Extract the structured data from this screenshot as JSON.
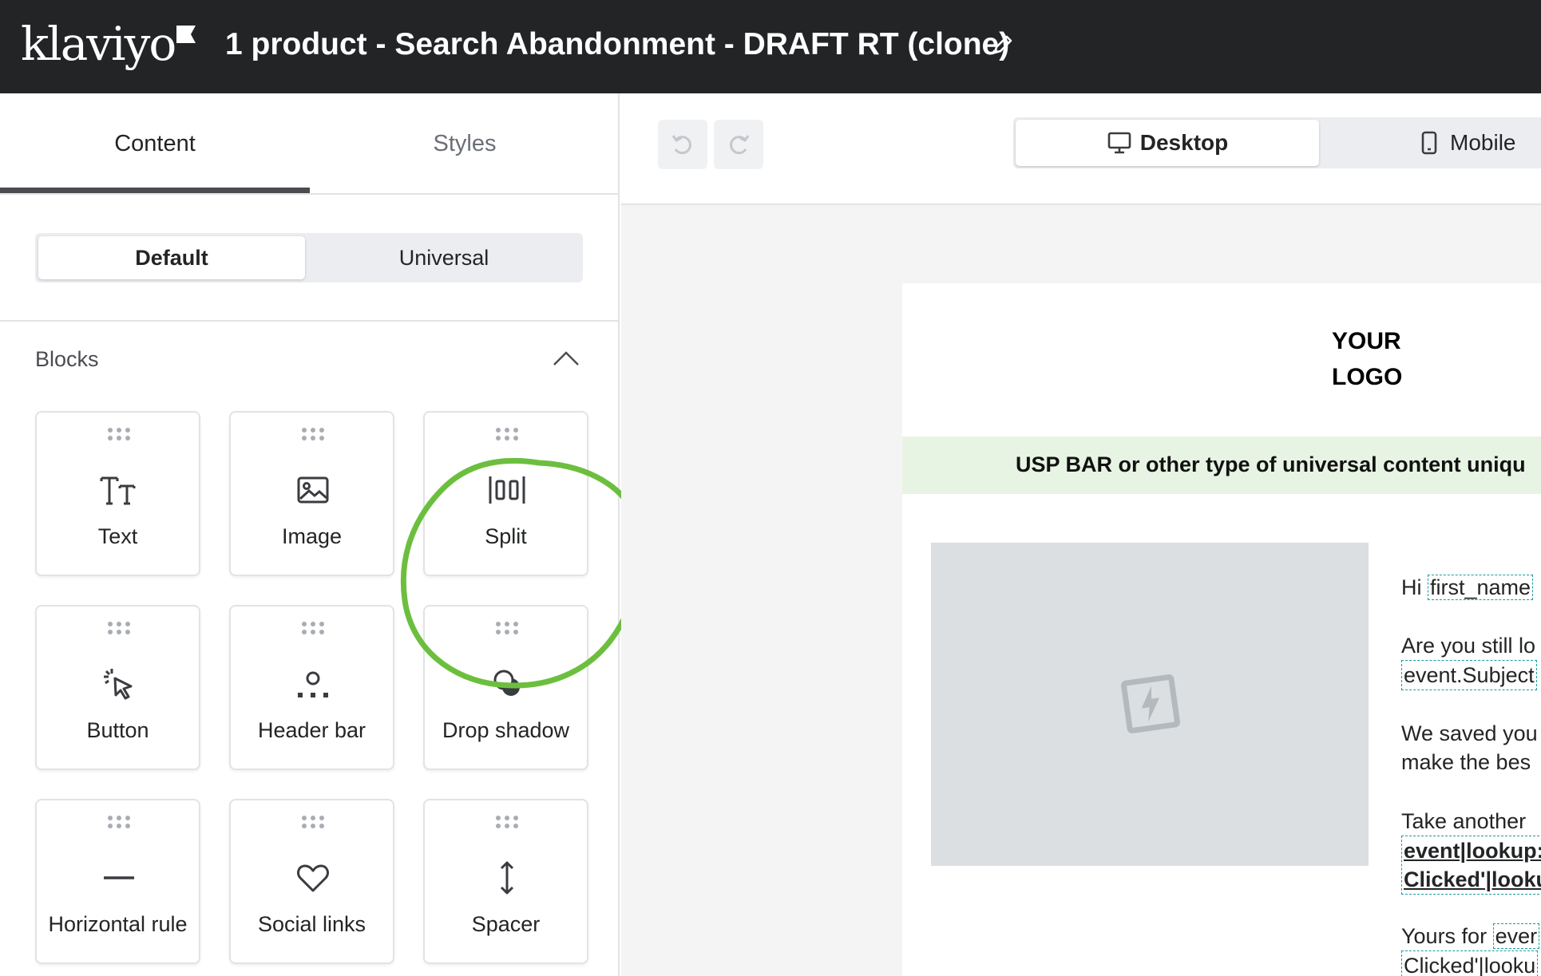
{
  "header": {
    "logo_text": "klaviyo",
    "title": "1 product - Search Abandonment - DRAFT RT (clone)",
    "edit_icon": "pencil-icon"
  },
  "left_panel": {
    "tabs": [
      {
        "label": "Content",
        "active": true
      },
      {
        "label": "Styles",
        "active": false
      }
    ],
    "segment": {
      "default_label": "Default",
      "universal_label": "Universal",
      "selected": "Default"
    },
    "blocks_title": "Blocks",
    "blocks": [
      {
        "label": "Text",
        "icon": "text-icon"
      },
      {
        "label": "Image",
        "icon": "image-icon"
      },
      {
        "label": "Split",
        "icon": "split-icon"
      },
      {
        "label": "Button",
        "icon": "cursor-click-icon"
      },
      {
        "label": "Header bar",
        "icon": "header-bar-icon"
      },
      {
        "label": "Drop shadow",
        "icon": "drop-shadow-icon"
      },
      {
        "label": "Horizontal rule",
        "icon": "horizontal-rule-icon"
      },
      {
        "label": "Social links",
        "icon": "heart-icon"
      },
      {
        "label": "Spacer",
        "icon": "vertical-arrows-icon"
      }
    ],
    "highlight_color": "#6cbf3e"
  },
  "toolbar": {
    "undo_icon": "undo-icon",
    "redo_icon": "redo-icon",
    "views": [
      {
        "label": "Desktop",
        "icon": "monitor-icon",
        "active": true
      },
      {
        "label": "Mobile",
        "icon": "phone-icon",
        "active": false
      }
    ]
  },
  "email": {
    "logo_line1": "YOUR",
    "logo_line2": "LOGO",
    "usp_text": "USP BAR or other type of universal content uniqu",
    "usp_color": "#e8f4e3",
    "lines": {
      "hi_prefix": "Hi",
      "hi_tag": "first_name",
      "still_looking": "Are you still lo",
      "subject_tag": "event.Subject",
      "saved_line1": "We saved you",
      "saved_line2": "make the bes",
      "take_another": "Take another",
      "lookup_line1": "event|lookup:",
      "lookup_line2": "Clicked'|looku",
      "yours_prefix": "Yours for",
      "yours_tag": "ever",
      "clicked_line": "Clicked'|looku"
    }
  }
}
